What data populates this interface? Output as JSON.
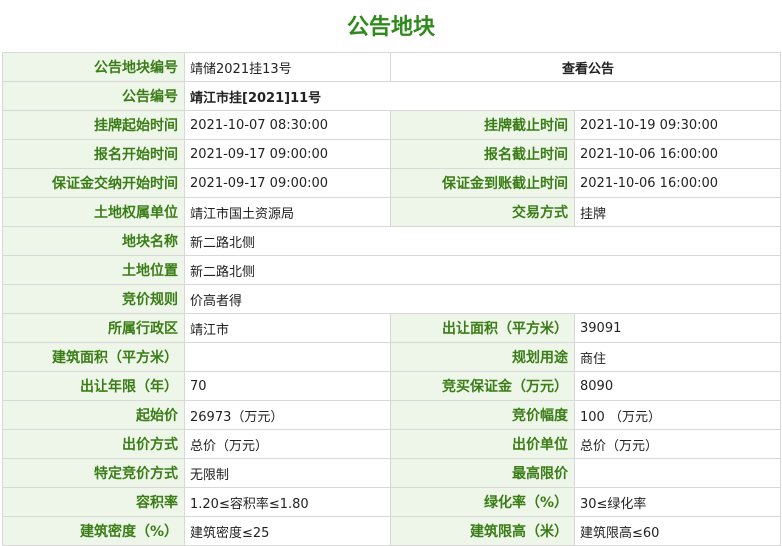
{
  "page_title": "公告地块",
  "view_notice_label": "查看公告",
  "rows": [
    {
      "k1": "公告地块编号",
      "v1": "靖储2021挂13号"
    },
    {
      "k1": "公告编号",
      "v1": "靖江市挂[2021]11号"
    },
    {
      "k1": "挂牌起始时间",
      "v1": "2021-10-07 08:30:00",
      "k2": "挂牌截止时间",
      "v2": "2021-10-19 09:30:00"
    },
    {
      "k1": "报名开始时间",
      "v1": "2021-09-17 09:00:00",
      "k2": "报名截止时间",
      "v2": "2021-10-06 16:00:00"
    },
    {
      "k1": "保证金交纳开始时间",
      "v1": "2021-09-17 09:00:00",
      "k2": "保证金到账截止时间",
      "v2": "2021-10-06 16:00:00"
    },
    {
      "k1": "土地权属单位",
      "v1": "靖江市国土资源局",
      "k2": "交易方式",
      "v2": "挂牌"
    },
    {
      "k1": "地块名称",
      "v1": "新二路北侧"
    },
    {
      "k1": "土地位置",
      "v1": "新二路北侧"
    },
    {
      "k1": "竞价规则",
      "v1": "价高者得"
    },
    {
      "k1": "所属行政区",
      "v1": "靖江市",
      "k2": "出让面积（平方米）",
      "v2": "39091"
    },
    {
      "k1": "建筑面积（平方米）",
      "v1": "",
      "k2": "规划用途",
      "v2": "商住"
    },
    {
      "k1": "出让年限（年）",
      "v1": "70",
      "k2": "竞买保证金（万元）",
      "v2": "8090"
    },
    {
      "k1": "起始价",
      "v1": "26973（万元）",
      "k2": "竞价幅度",
      "v2": "100 （万元）"
    },
    {
      "k1": "出价方式",
      "v1": "总价（万元）",
      "k2": "出价单位",
      "v2": "总价（万元）"
    },
    {
      "k1": "特定竞价方式",
      "v1": "无限制",
      "k2": "最高限价",
      "v2": ""
    },
    {
      "k1": "容积率",
      "v1": "1.20≤容积率≤1.80",
      "k2": "绿化率（%）",
      "v2": "30≤绿化率"
    },
    {
      "k1": "建筑密度（%）",
      "v1": "建筑密度≤25",
      "k2": "建筑限高（米）",
      "v2": "建筑限高≤60"
    }
  ]
}
